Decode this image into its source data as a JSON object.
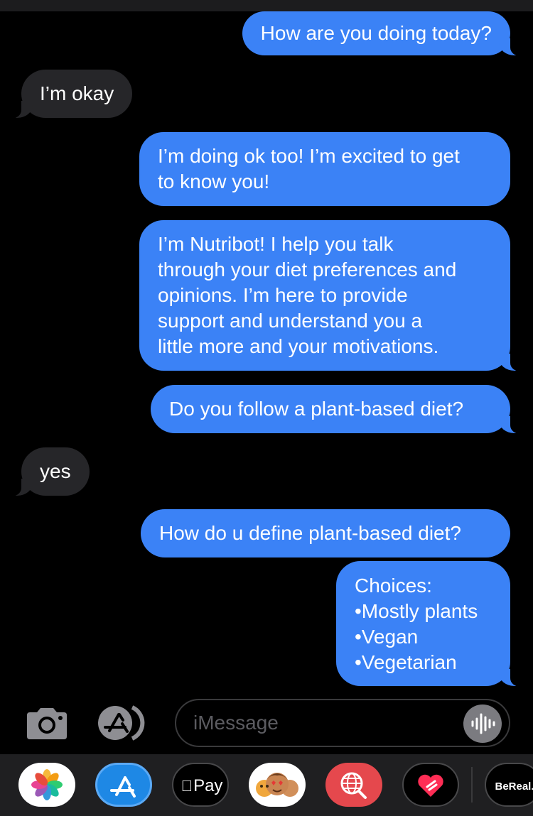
{
  "conversation": {
    "messages": [
      {
        "sender": "me",
        "text": "How are you doing today?"
      },
      {
        "sender": "them",
        "text": "I’m okay"
      },
      {
        "sender": "me",
        "text": "I’m doing ok too! I’m excited to get\nto know you!"
      },
      {
        "sender": "me",
        "text": "I’m Nutribot! I help you talk\nthrough your diet preferences and\nopinions. I’m here to provide\nsupport and understand you a\nlittle more and your motivations."
      },
      {
        "sender": "me",
        "text": "Do you follow a plant-based diet?"
      },
      {
        "sender": "them",
        "text": "yes"
      },
      {
        "sender": "me",
        "text": "How do u define plant-based diet?"
      },
      {
        "sender": "me",
        "text": "Choices:\n•Mostly plants\n•Vegan\n•Vegetarian"
      }
    ]
  },
  "composer": {
    "placeholder": "iMessage",
    "camera_icon": "camera-icon",
    "apps_icon": "app-store-icon",
    "audio_icon": "audio-waveform-icon"
  },
  "dock": {
    "apps": [
      {
        "name": "Photos",
        "icon": "photos-icon"
      },
      {
        "name": "App Store",
        "icon": "app-store-icon"
      },
      {
        "name": "Apple Pay",
        "icon": "apple-pay-icon",
        "label": "Pay"
      },
      {
        "name": "Memoji",
        "icon": "memoji-icon"
      },
      {
        "name": "Search Images",
        "icon": "globe-search-icon"
      },
      {
        "name": "Digital Touch",
        "icon": "heart-icon"
      },
      {
        "name": "BeReal",
        "icon": "bereal-icon",
        "label": "BeReal."
      }
    ]
  },
  "colors": {
    "outgoing_bubble": "#3b82f6",
    "incoming_bubble": "#262629",
    "background": "#000000",
    "dock_background": "#1f1f21"
  }
}
